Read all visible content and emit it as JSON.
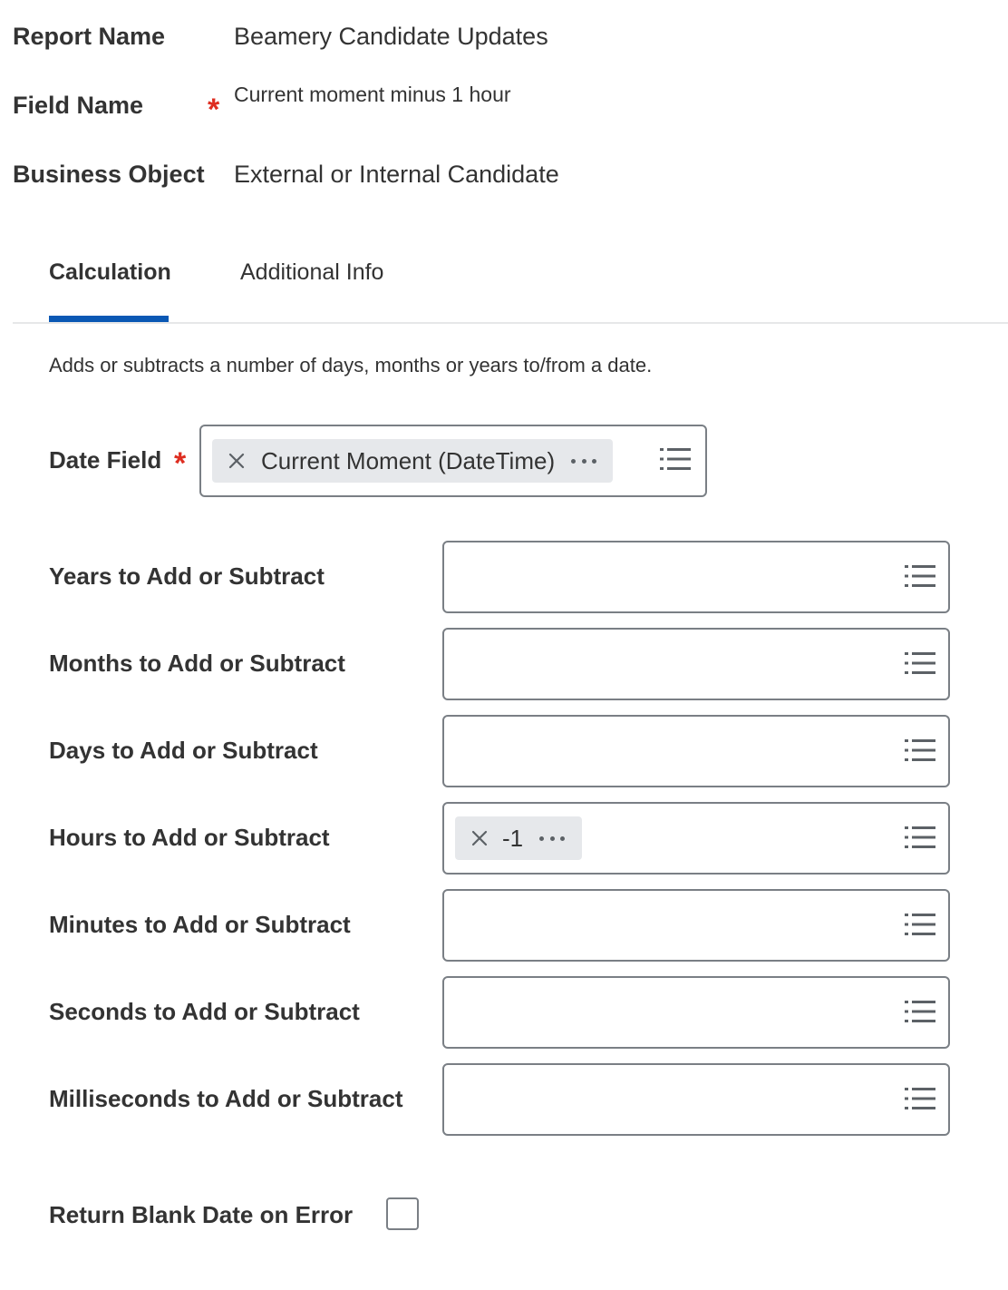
{
  "header": {
    "report_name_label": "Report Name",
    "report_name_value": "Beamery Candidate Updates",
    "field_name_label": "Field Name",
    "field_name_value": "Current moment minus 1 hour",
    "business_object_label": "Business Object",
    "business_object_value": "External or Internal Candidate",
    "required_marker": "*"
  },
  "tabs": [
    {
      "label": "Calculation",
      "active": true
    },
    {
      "label": "Additional Info",
      "active": false
    }
  ],
  "description": "Adds or subtracts a number of days, months or years to/from a date.",
  "date_field": {
    "label": "Date Field",
    "required_marker": "*",
    "value": "Current Moment (DateTime)"
  },
  "fields": [
    {
      "label": "Years to Add or Subtract",
      "value": ""
    },
    {
      "label": "Months to Add or Subtract",
      "value": ""
    },
    {
      "label": "Days to Add or Subtract",
      "value": ""
    },
    {
      "label": "Hours to Add or Subtract",
      "value": "-1"
    },
    {
      "label": "Minutes to Add or Subtract",
      "value": ""
    },
    {
      "label": "Seconds to Add or Subtract",
      "value": ""
    },
    {
      "label": "Milliseconds to Add or Subtract",
      "value": ""
    }
  ],
  "return_blank": {
    "label": "Return Blank Date on Error",
    "checked": false
  },
  "icons": {
    "prompt": "list-icon",
    "remove": "close-icon",
    "related_actions": "more-icon"
  },
  "colors": {
    "accent": "#0a58b4",
    "required": "#de2e21",
    "pill_bg": "#e6e8eb",
    "border": "#7a7f85"
  }
}
